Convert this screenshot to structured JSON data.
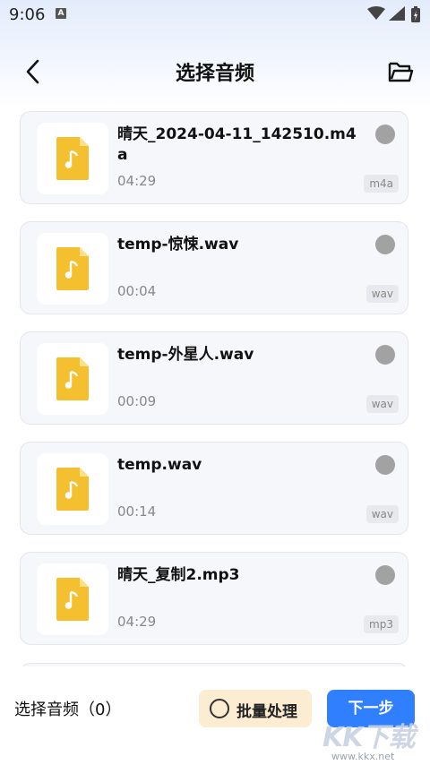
{
  "status_bar": {
    "time": "9:06",
    "icons": [
      "a-icon",
      "wifi-icon",
      "signal-icon",
      "battery-icon"
    ]
  },
  "header": {
    "title": "选择音频",
    "back_icon": "chevron-left-icon",
    "folder_icon": "folder-open-icon"
  },
  "files": [
    {
      "name": "晴天_2024-04-11_142510.m4a",
      "duration": "04:29",
      "ext": "m4a"
    },
    {
      "name": "temp-惊悚.wav",
      "duration": "00:04",
      "ext": "wav"
    },
    {
      "name": "temp-外星人.wav",
      "duration": "00:09",
      "ext": "wav"
    },
    {
      "name": "temp.wav",
      "duration": "00:14",
      "ext": "wav"
    },
    {
      "name": "晴天_复制2.mp3",
      "duration": "04:29",
      "ext": "mp3"
    }
  ],
  "bottom": {
    "selected_label": "选择音频（0）",
    "batch_label": "批量处理",
    "next_label": "下一步"
  },
  "watermark": {
    "url": "www.kkx.net"
  },
  "colors": {
    "accent": "#2f7fff",
    "batch_bg": "#fcecd2",
    "file_icon": "#f5c030"
  }
}
